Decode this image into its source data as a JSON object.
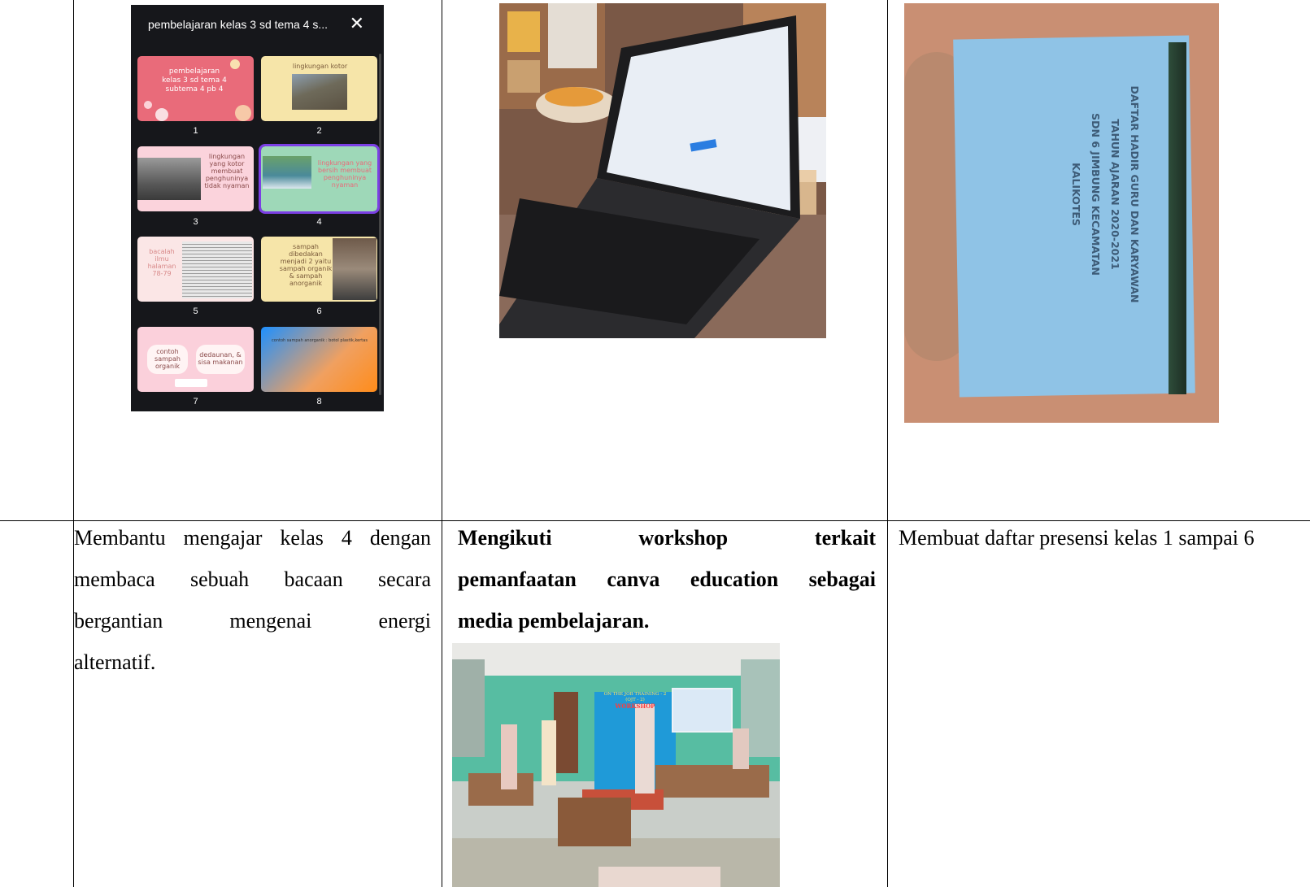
{
  "canva": {
    "title": "pembelajaran kelas 3 sd tema 4 s...",
    "close": "✕",
    "slides": [
      {
        "num": "1",
        "text": "pembelajaran kelas 3 sd tema 4 subtema 4 pb 4"
      },
      {
        "num": "2",
        "text": "lingkungan kotor"
      },
      {
        "num": "3",
        "text": "lingkungan yang kotor membuat penghuninya tidak nyaman"
      },
      {
        "num": "4",
        "text": "lingkungan yang bersih membuat penghuninya nyaman"
      },
      {
        "num": "5",
        "text": "bacalah ilmu halaman 78-79"
      },
      {
        "num": "6",
        "text": "sampah dibedakan menjadi 2 yaitu sampah organik & sampah anorganik"
      },
      {
        "num": "7",
        "text_a": "contoh sampah organik",
        "text_b": "dedaunan, & sisa makanan"
      },
      {
        "num": "8",
        "text": "contoh sampah anorganik : botol plastik,kertas"
      }
    ]
  },
  "book": {
    "line1": "DAFTAR HADIR GURU DAN KARYAWAN",
    "line2": "TAHUN AJARAN 2020-2021",
    "line3": "SDN 6 JIMBUNG KECAMATAN",
    "line4": "KALIKOTES"
  },
  "workshop_banner": {
    "line1": "ON THE JOB TRAINING - 2",
    "line2": "(OJT - 2)",
    "line3": "WORKSHOP"
  },
  "cells": {
    "col1": {
      "l1": "Membantu mengajar kelas 4 dengan",
      "l2": "membaca sebuah bacaan secara",
      "l3": "bergantian mengenai energi",
      "l4": "alternatif."
    },
    "col2": {
      "l1": "Mengikuti workshop terkait",
      "l2": "pemanfaatan canva education sebagai",
      "l3": "media pembelajaran."
    },
    "col3": {
      "l1": "Membuat daftar presensi kelas 1 sampai 6"
    }
  }
}
